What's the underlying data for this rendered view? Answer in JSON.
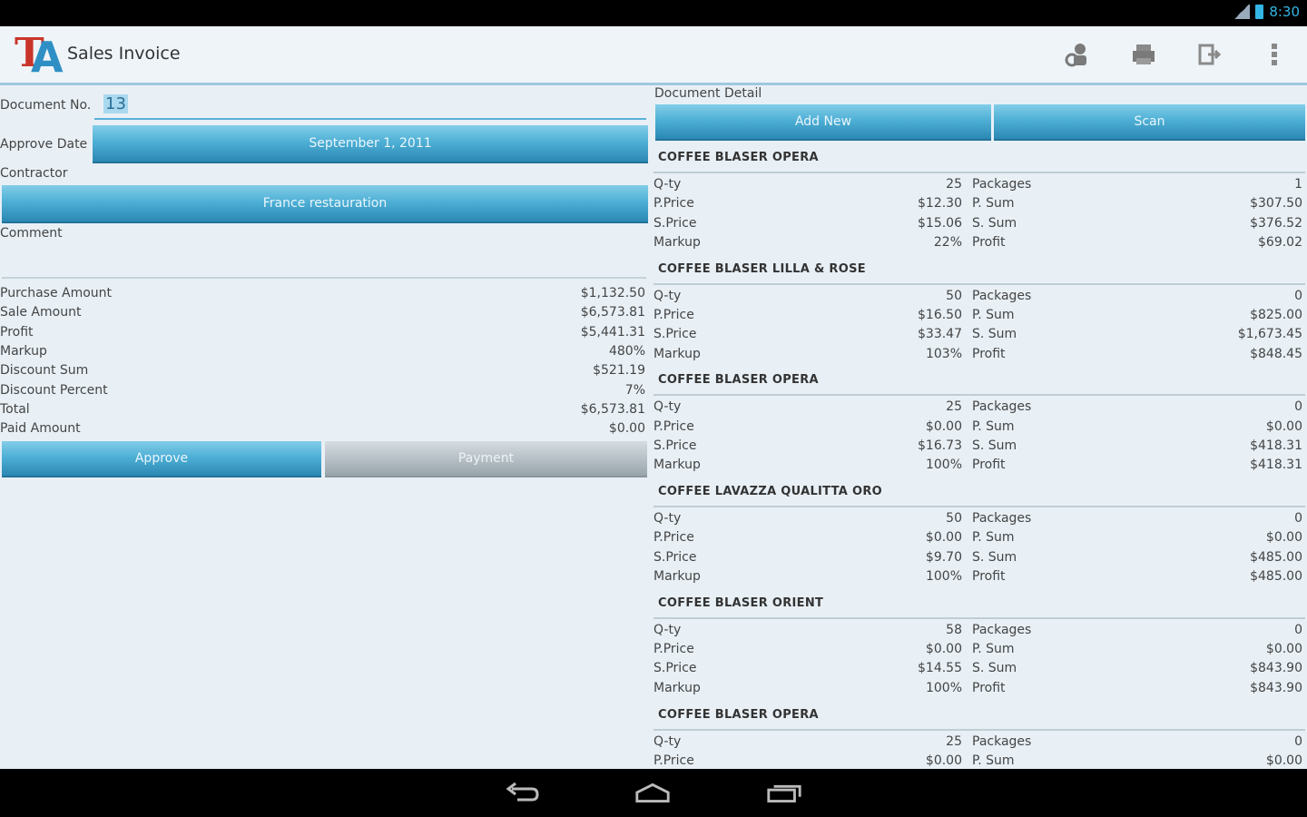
{
  "status": {
    "time": "8:30"
  },
  "app": {
    "title": "Sales Invoice",
    "logo_t": "T",
    "logo_a": "A"
  },
  "actionbar_icons": [
    "contractor-icon",
    "print-icon",
    "export-icon",
    "overflow-menu-icon"
  ],
  "form": {
    "doc_no_label": "Document No.",
    "doc_no_value": "13",
    "approve_date_label": "Approve Date",
    "approve_date_value": "September 1, 2011",
    "contractor_label": "Contractor",
    "contractor_value": "France restauration",
    "comment_label": "Comment",
    "comment_value": ""
  },
  "summary": [
    {
      "label": "Purchase Amount",
      "value": "$1,132.50"
    },
    {
      "label": "Sale Amount",
      "value": "$6,573.81"
    },
    {
      "label": "Profit",
      "value": "$5,441.31"
    },
    {
      "label": "Markup",
      "value": "480%"
    },
    {
      "label": "Discount Sum",
      "value": "$521.19"
    },
    {
      "label": "Discount Percent",
      "value": "7%"
    },
    {
      "label": "Total",
      "value": "$6,573.81"
    },
    {
      "label": "Paid Amount",
      "value": "$0.00"
    }
  ],
  "buttons": {
    "approve": "Approve",
    "payment": "Payment",
    "add_new": "Add New",
    "scan": "Scan"
  },
  "detail": {
    "header": "Document Detail",
    "row_labels": {
      "qty": "Q-ty",
      "pprice": "P.Price",
      "sprice": "S.Price",
      "markup": "Markup"
    },
    "col_labels": {
      "packages": "Packages",
      "psum": "P. Sum",
      "ssum": "S. Sum",
      "profit": "Profit"
    },
    "items": [
      {
        "name": "COFFEE BLASER OPERA",
        "qty": "25",
        "pprice": "$12.30",
        "sprice": "$15.06",
        "markup": "22%",
        "packages": "1",
        "psum": "$307.50",
        "ssum": "$376.52",
        "profit": "$69.02"
      },
      {
        "name": "COFFEE BLASER LILLA & ROSE",
        "qty": "50",
        "pprice": "$16.50",
        "sprice": "$33.47",
        "markup": "103%",
        "packages": "0",
        "psum": "$825.00",
        "ssum": "$1,673.45",
        "profit": "$848.45"
      },
      {
        "name": "COFFEE BLASER OPERA",
        "qty": "25",
        "pprice": "$0.00",
        "sprice": "$16.73",
        "markup": "100%",
        "packages": "0",
        "psum": "$0.00",
        "ssum": "$418.31",
        "profit": "$418.31"
      },
      {
        "name": "COFFEE LAVAZZA QUALITTA ORO",
        "qty": "50",
        "pprice": "$0.00",
        "sprice": "$9.70",
        "markup": "100%",
        "packages": "0",
        "psum": "$0.00",
        "ssum": "$485.00",
        "profit": "$485.00"
      },
      {
        "name": "COFFEE BLASER ORIENT",
        "qty": "58",
        "pprice": "$0.00",
        "sprice": "$14.55",
        "markup": "100%",
        "packages": "0",
        "psum": "$0.00",
        "ssum": "$843.90",
        "profit": "$843.90"
      },
      {
        "name": "COFFEE BLASER OPERA",
        "qty": "25",
        "pprice": "$0.00",
        "sprice": "",
        "markup": "",
        "packages": "0",
        "psum": "$0.00",
        "ssum": "",
        "profit": ""
      }
    ]
  },
  "nav_icons": [
    "back-icon",
    "home-icon",
    "recents-icon"
  ]
}
